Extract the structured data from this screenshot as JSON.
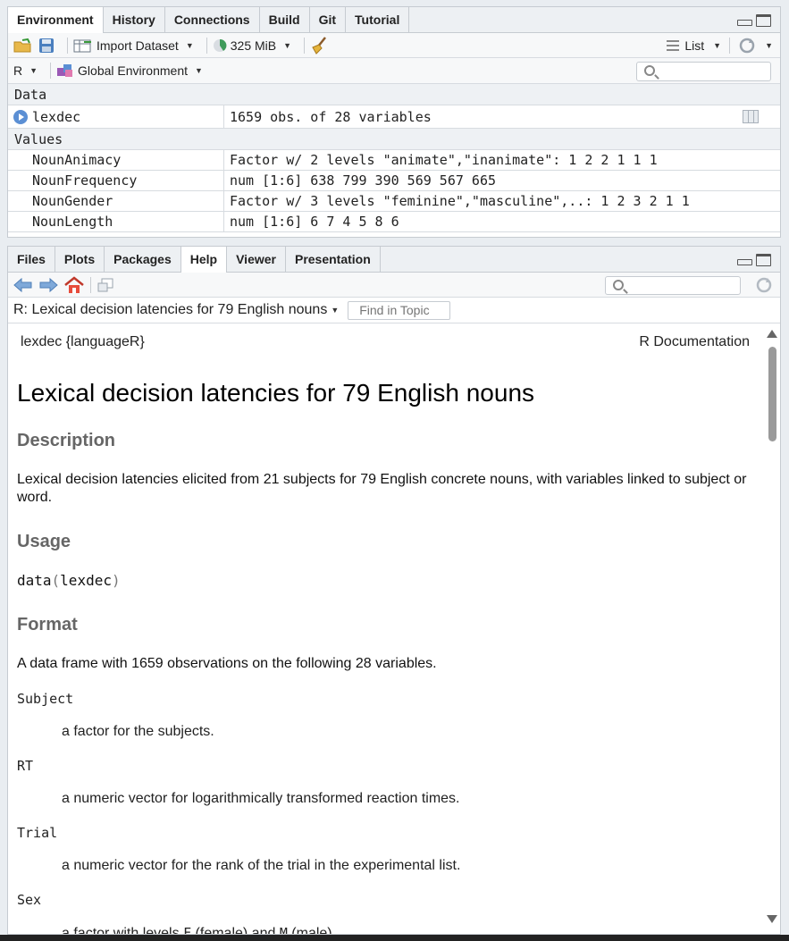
{
  "env": {
    "tabs": [
      "Environment",
      "History",
      "Connections",
      "Build",
      "Git",
      "Tutorial"
    ],
    "toolbar": {
      "import_label": "Import Dataset",
      "memory_label": "325 MiB",
      "view_label": "List"
    },
    "lang_label": "R",
    "scope_label": "Global Environment",
    "data_header": "Data",
    "values_header": "Values",
    "data_rows": [
      {
        "name": "lexdec",
        "value": "1659 obs. of 28 variables"
      }
    ],
    "value_rows": [
      {
        "name": "NounAnimacy",
        "value": "Factor w/ 2 levels \"animate\",\"inanimate\": 1 2 2 1 1 1"
      },
      {
        "name": "NounFrequency",
        "value": "num [1:6] 638 799 390 569 567 665"
      },
      {
        "name": "NounGender",
        "value": "Factor w/ 3 levels \"feminine\",\"masculine\",..: 1 2 3 2 1 1"
      },
      {
        "name": "NounLength",
        "value": "num [1:6] 6 7 4 5 8 6"
      }
    ]
  },
  "help": {
    "tabs": [
      "Files",
      "Plots",
      "Packages",
      "Help",
      "Viewer",
      "Presentation"
    ],
    "topic_title": "R: Lexical decision latencies for 79 English nouns",
    "find_placeholder": "Find in Topic",
    "doc_left": "lexdec {languageR}",
    "doc_right": "R Documentation",
    "title": "Lexical decision latencies for 79 English nouns",
    "desc_heading": "Description",
    "desc_text": "Lexical decision latencies elicited from 21 subjects for 79 English concrete nouns, with variables linked to subject or word.",
    "usage_heading": "Usage",
    "usage_fn": "data",
    "usage_open": "(",
    "usage_arg": "lexdec",
    "usage_close": ")",
    "format_heading": "Format",
    "format_text": "A data frame with 1659 observations on the following 28 variables.",
    "vars": [
      {
        "name": "Subject",
        "desc": "a factor for the subjects."
      },
      {
        "name": "RT",
        "desc": "a numeric vector for logarithmically transformed reaction times."
      },
      {
        "name": "Trial",
        "desc": "a numeric vector for the rank of the trial in the experimental list."
      }
    ],
    "sex": {
      "name": "Sex",
      "pre": "a factor with levels ",
      "f": "F",
      "mid": " (female) and ",
      "m": "M",
      "post": " (male)."
    }
  }
}
